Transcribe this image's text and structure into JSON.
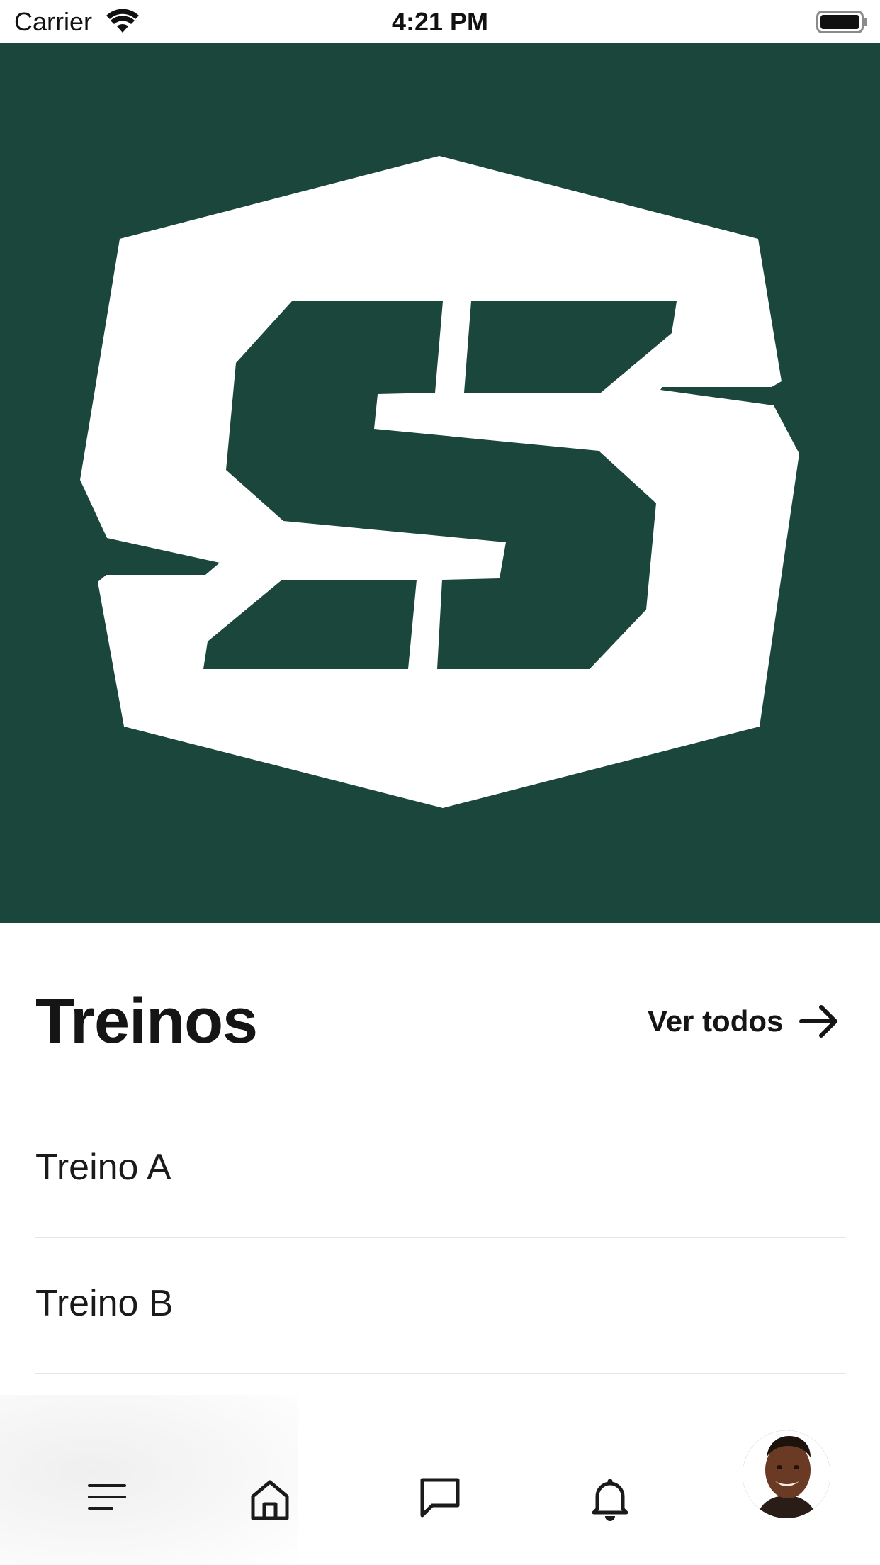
{
  "status_bar": {
    "carrier": "Carrier",
    "time": "4:21 PM"
  },
  "hero": {
    "logo": "S-shield-logo",
    "background_color": "#1b463c",
    "logo_color": "#ffffff"
  },
  "workouts": {
    "title": "Treinos",
    "see_all_label": "Ver todos",
    "see_all_icon": "arrow-right-icon",
    "items": [
      {
        "label": "Treino A"
      },
      {
        "label": "Treino B"
      }
    ]
  },
  "bottom_nav": {
    "items": [
      {
        "icon": "menu-icon"
      },
      {
        "icon": "home-icon"
      },
      {
        "icon": "chat-icon"
      },
      {
        "icon": "bell-icon"
      },
      {
        "icon": "avatar"
      }
    ]
  }
}
